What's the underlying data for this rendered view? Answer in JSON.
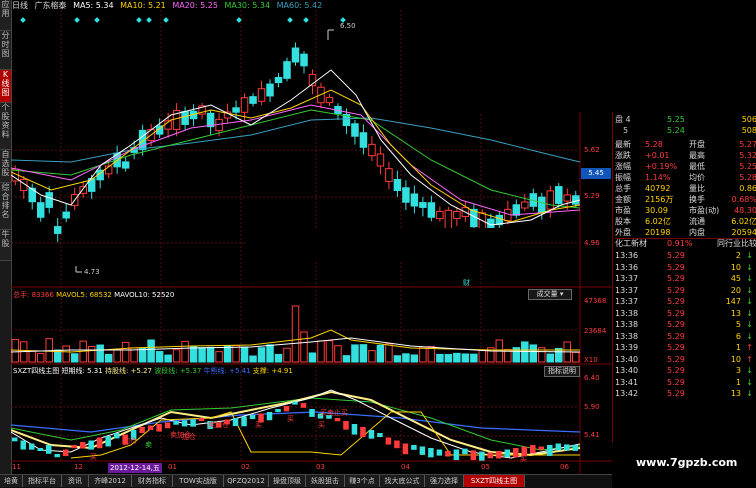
{
  "sidebar": {
    "tabs": [
      {
        "label": "应用",
        "active": false
      },
      {
        "label": "分时图",
        "active": false
      },
      {
        "label": "K线图",
        "active": true
      },
      {
        "label": "个股资料",
        "active": false
      },
      {
        "label": "自选股",
        "active": false
      },
      {
        "label": "综合排名",
        "active": false
      },
      {
        "label": "牛股",
        "active": false
      }
    ]
  },
  "header": {
    "period": "日线",
    "stock": "广东榕泰",
    "ma5": "MA5: 5.34",
    "ma10": "MA10: 5.21",
    "ma20": "MA20: 5.25",
    "ma30": "MA30: 5.34",
    "ma60": "MA60: 5.42"
  },
  "price_chart": {
    "high_label": "6.50",
    "low_label": "4.73",
    "y_labels": [
      "5.62",
      "5.45",
      "5.29",
      "4.96"
    ],
    "current_tag": "5.45",
    "marker": "财"
  },
  "volume": {
    "title": "总手: 83366",
    "mavol5": "MAVOL5: 68532",
    "mavol10": "MAVOL10: 52520",
    "button": "成交量",
    "y_labels": [
      "47368",
      "23684",
      "X10"
    ]
  },
  "indicator": {
    "title": "SXZT四线主图",
    "short_line": "短期线: 5.31",
    "hold_line": "持股线: +5.27",
    "wave_line": "波段线: +5.37",
    "bull_bear": "牛熊线: +5.41",
    "support": "支撑: +4.91",
    "button": "指标说明",
    "y_labels": [
      "6.40",
      "5.90",
      "5.41"
    ],
    "signals": [
      "买",
      "加仓",
      "卖",
      "加仓",
      "买",
      "买",
      "卖加仓",
      "卖加仓",
      "买卖止买",
      "买",
      "买"
    ]
  },
  "x_axis": {
    "labels": [
      "11",
      "12",
      "2012-12-14,五",
      "01",
      "02",
      "03",
      "04",
      "05",
      "06"
    ]
  },
  "quote_panel": {
    "ask_rows": [
      {
        "label": "盘 4",
        "price": "5.25",
        "vol": "506"
      },
      {
        "label": "5",
        "price": "5.24",
        "vol": "508"
      }
    ],
    "stats": [
      {
        "k1": "最新",
        "v1": "5.28",
        "k2": "开盘",
        "v2": "5.27"
      },
      {
        "k1": "涨跌",
        "v1": "+0.01",
        "k2": "最高",
        "v2": "5.32"
      },
      {
        "k1": "涨幅",
        "v1": "+0.19%",
        "k2": "最低",
        "v2": "5.25"
      },
      {
        "k1": "振幅",
        "v1": "1.14%",
        "k2": "均价",
        "v2": "5.28"
      },
      {
        "k1": "总手",
        "v1": "40792",
        "k2": "量比",
        "v2": "0.86"
      },
      {
        "k1": "金额",
        "v1": "2156万",
        "k2": "换手",
        "v2": "0.68%"
      },
      {
        "k1": "市盈",
        "v1": "30.09",
        "k2": "市盈(动)",
        "v2": "48.30"
      },
      {
        "k1": "股本",
        "v1": "6.02亿",
        "k2": "流通",
        "v2": "6.02亿"
      },
      {
        "k1": "外盘",
        "v1": "20198",
        "k2": "内盘",
        "v2": "20594"
      }
    ],
    "sector": {
      "name": "化工新材",
      "pct": "0.91%",
      "compare": "同行业比较"
    },
    "ticks": [
      {
        "time": "13:36",
        "price": "5.29",
        "vol": "2",
        "dir": "down"
      },
      {
        "time": "13:36",
        "price": "5.29",
        "vol": "10",
        "dir": "down"
      },
      {
        "time": "13:37",
        "price": "5.29",
        "vol": "45",
        "dir": "down"
      },
      {
        "time": "13:37",
        "price": "5.29",
        "vol": "20",
        "dir": "down"
      },
      {
        "time": "13:37",
        "price": "5.29",
        "vol": "147",
        "dir": "down"
      },
      {
        "time": "13:38",
        "price": "5.29",
        "vol": "13",
        "dir": "down"
      },
      {
        "time": "13:38",
        "price": "5.29",
        "vol": "5",
        "dir": "down"
      },
      {
        "time": "13:38",
        "price": "5.29",
        "vol": "6",
        "dir": "down"
      },
      {
        "time": "13:39",
        "price": "5.29",
        "vol": "1",
        "dir": "up"
      },
      {
        "time": "13:40",
        "price": "5.29",
        "vol": "10",
        "dir": "up"
      },
      {
        "time": "13:40",
        "price": "5.29",
        "vol": "3",
        "dir": "down"
      },
      {
        "time": "13:41",
        "price": "5.29",
        "vol": "1",
        "dir": "down"
      },
      {
        "time": "13:42",
        "price": "5.29",
        "vol": "13",
        "dir": "down"
      }
    ]
  },
  "tabs": [
    {
      "label": "培黄",
      "active": false
    },
    {
      "label": "指标平台",
      "active": false
    },
    {
      "label": "资讯",
      "active": false
    },
    {
      "label": "齐峰2012",
      "active": false
    },
    {
      "label": "财务指标",
      "active": false
    },
    {
      "label": "TOW实战版",
      "active": false
    },
    {
      "label": "QFZQ2012",
      "active": false
    },
    {
      "label": "操盘顶级",
      "active": false
    },
    {
      "label": "妖股狙击",
      "active": false
    },
    {
      "label": "赚3个点",
      "active": false
    },
    {
      "label": "找大底公式",
      "active": false
    },
    {
      "label": "强力选择",
      "active": false
    },
    {
      "label": "SXZT四线主图",
      "active": true
    }
  ],
  "watermark": "www.7gpzb.com",
  "colors": {
    "up": "#ff3b3b",
    "down": "#33e0e0",
    "ma5": "#ffffff",
    "ma10": "#ffd400",
    "ma20": "#ff66ff",
    "ma30": "#33cc33",
    "ma60": "#3aa0c0",
    "accent": "#b00000"
  }
}
